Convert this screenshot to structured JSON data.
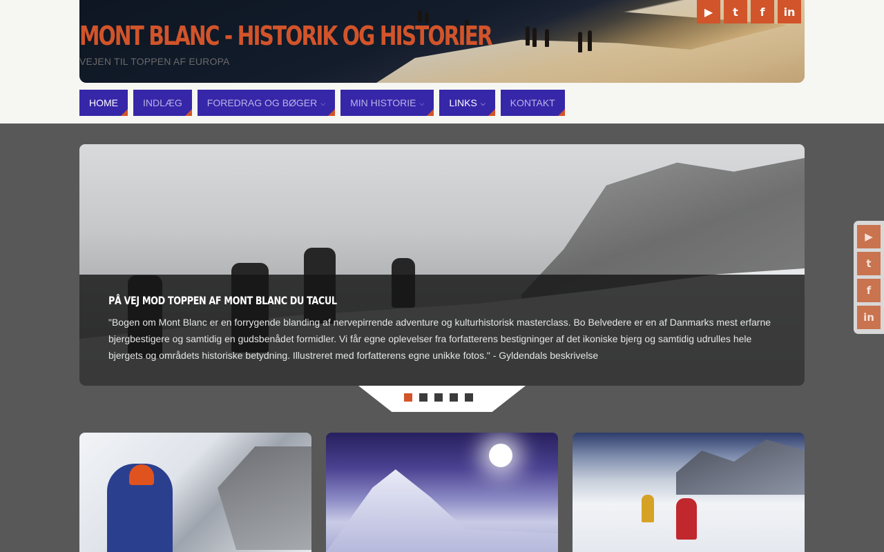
{
  "site": {
    "title": "MONT BLANC - HISTORIK OG HISTORIER",
    "tagline": "VEJEN TIL TOPPEN AF EUROPA"
  },
  "social": [
    {
      "name": "youtube",
      "glyph": "▶"
    },
    {
      "name": "twitter",
      "glyph": "t"
    },
    {
      "name": "facebook",
      "glyph": "f"
    },
    {
      "name": "linkedin",
      "glyph": "in"
    }
  ],
  "nav": {
    "items": [
      {
        "label": "HOME",
        "active": true
      },
      {
        "label": "INDLÆG"
      },
      {
        "label": "FOREDRAG OG BØGER",
        "dropdown": true
      },
      {
        "label": "MIN HISTORIE",
        "dropdown": true
      },
      {
        "label": "LINKS",
        "dropdown": true
      },
      {
        "label": "KONTAKT"
      }
    ]
  },
  "slider": {
    "title": "PÅ VEJ MOD TOPPEN AF MONT BLANC DU TACUL",
    "text": "\"Bogen om Mont Blanc er en forrygende blanding af nervepirrende adventure og kulturhistorisk masterclass. Bo Belvedere er en af Danmarks mest erfarne bjergbestigere og samtidig en gudsbenådet formidler. Vi får egne oplevelser fra forfatterens bestigninger af det ikoniske bjerg og samtidig udrulles hele bjergets og områdets historiske betydning. Illustreret med forfatterens egne unikke fotos.\" - Gyldendals beskrivelse",
    "current_slide": 1,
    "total_slides": 5
  },
  "colors": {
    "accent": "#d2542a",
    "nav_bg": "#3626a8",
    "page_bg": "#585858",
    "header_bg": "#f6f6f2"
  }
}
